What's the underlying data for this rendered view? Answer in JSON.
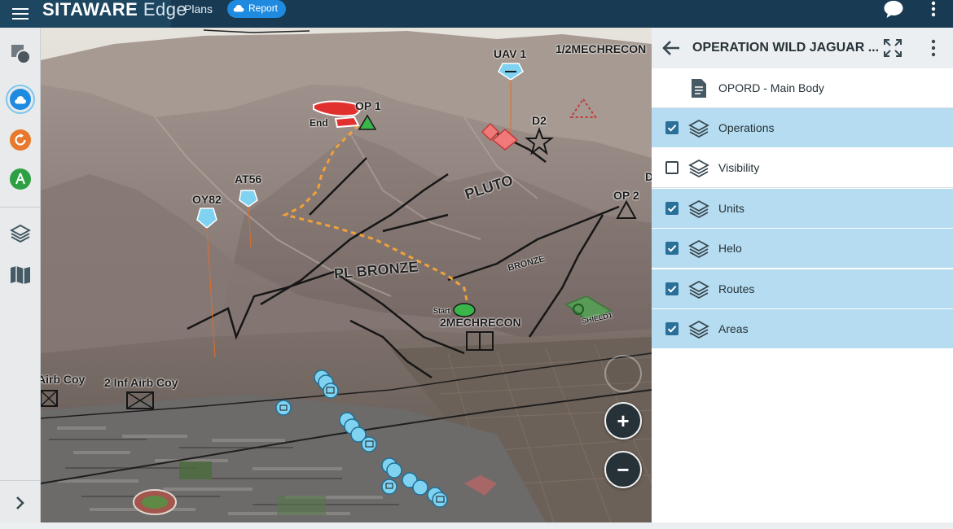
{
  "app": {
    "brand_bold": "SITAWARE",
    "brand_light": " Edge",
    "nav_plans": "Plans",
    "report_label": "Report"
  },
  "map": {
    "labels": {
      "mechrecon_half": "1/2MECHRECON",
      "uav1": "UAV 1",
      "op1": "OP 1",
      "end": "End",
      "d2": "D2",
      "at56": "AT56",
      "oy82": "OY82",
      "op2": "OP 2",
      "pluto": "PLUTO",
      "pl_bronze": "PL BRONZE",
      "bronze": "BRONZE",
      "start": "Start",
      "mechrecon_2": "2MECHRECON",
      "shield": "SHIELD1",
      "airb_coy_left": "Airb Coy",
      "inf_airb_coy": "2 Inf Airb Coy",
      "d_edge": "D"
    },
    "zoom_in": "+",
    "zoom_out": "−"
  },
  "panel": {
    "title": "OPERATION WILD JAGUAR ...",
    "opord": "OPORD - Main Body",
    "layers": [
      {
        "label": "Operations",
        "checked": true
      },
      {
        "label": "Visibility",
        "checked": false
      },
      {
        "label": "Units",
        "checked": true
      },
      {
        "label": "Helo",
        "checked": true
      },
      {
        "label": "Routes",
        "checked": true
      },
      {
        "label": "Areas",
        "checked": true
      }
    ]
  },
  "icons": {
    "menu": "menu-icon",
    "chat": "chat-bubble-icon",
    "more": "more-vert-icon",
    "back": "arrow-back-icon",
    "expand": "fullscreen-icon",
    "document": "document-icon",
    "layers": "layers-icon"
  },
  "colors": {
    "topbar": "#183a52",
    "accent": "#1f8be0",
    "layer_on": "#b5dcf1",
    "checkbox": "#2a6f98",
    "hostile": "#f06f6f",
    "friendly": "#7fd3f0",
    "neutral": "#4caf50"
  }
}
